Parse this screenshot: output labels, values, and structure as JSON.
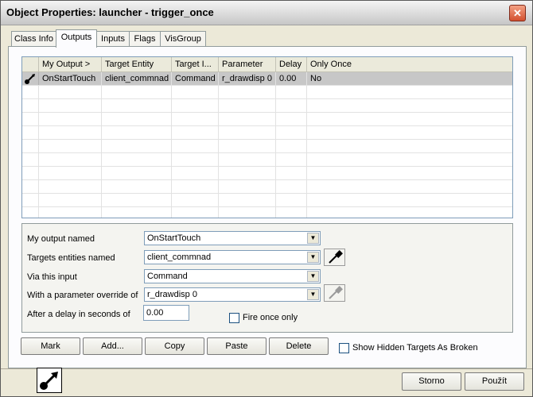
{
  "window": {
    "title": "Object Properties: launcher - trigger_once"
  },
  "tabs": [
    {
      "label": "Class Info"
    },
    {
      "label": "Outputs"
    },
    {
      "label": "Inputs"
    },
    {
      "label": "Flags"
    },
    {
      "label": "VisGroup"
    }
  ],
  "grid": {
    "columns": [
      "My Output  >",
      "Target Entity",
      "Target I...",
      "Parameter",
      "Delay",
      "Only Once"
    ],
    "rows": [
      {
        "icon": "output-connection-icon",
        "cells": [
          "OnStartTouch",
          "client_commnad",
          "Command",
          "r_drawdisp 0",
          "0.00",
          "No"
        ]
      }
    ]
  },
  "details": {
    "output_label": "My output named",
    "output_value": "OnStartTouch",
    "target_label": "Targets entities named",
    "target_value": "client_commnad",
    "input_label": "Via this input",
    "input_value": "Command",
    "param_label": "With a parameter override of",
    "param_value": "r_drawdisp 0",
    "delay_label": "After a delay in seconds of",
    "delay_value": "0.00",
    "fire_once_label": "Fire once only"
  },
  "actions": {
    "mark": "Mark",
    "add": "Add...",
    "copy": "Copy",
    "paste": "Paste",
    "delete": "Delete",
    "show_hidden_label": "Show Hidden Targets As Broken"
  },
  "footer": {
    "cancel": "Storno",
    "apply": "Použít",
    "entity_icon": "output-arrow-icon"
  },
  "colors": {
    "selected_row": "#c7c7c7",
    "panel": "#fcfcfe",
    "dialog": "#ece9d8"
  }
}
